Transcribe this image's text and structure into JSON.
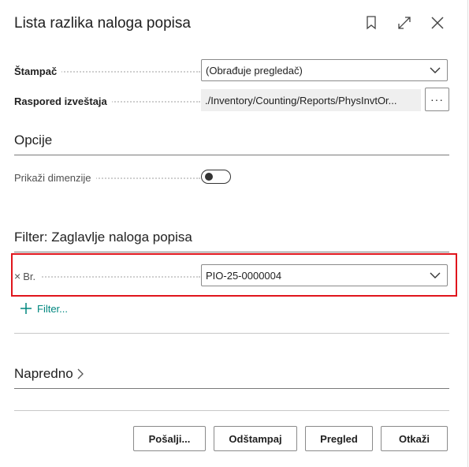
{
  "dialog": {
    "title": "Lista razlika naloga popisa",
    "icons": [
      "bookmark-icon",
      "expand-icon",
      "close-icon"
    ]
  },
  "fields": {
    "printer": {
      "label": "Štampač",
      "value": "(Obrađuje pregledač)"
    },
    "report_layout": {
      "label": "Raspored izveštaja",
      "value": "./Inventory/Counting/Reports/PhysInvtOr...",
      "more": "···"
    }
  },
  "options": {
    "title": "Opcije",
    "show_dimensions": {
      "label": "Prikaži dimenzije",
      "checked": false
    }
  },
  "filter": {
    "title": "Filter: Zaglavlje naloga popisa",
    "remove_symbol": "×",
    "field_label": "Br.",
    "field_value": "PIO-25-0000004",
    "add_filter_label": "Filter..."
  },
  "advanced": {
    "label": "Napredno",
    "chevron": "›"
  },
  "buttons": {
    "send": "Pošalji...",
    "print": "Odštampaj",
    "preview": "Pregled",
    "cancel": "Otkaži"
  },
  "colors": {
    "accent": "#00877f",
    "highlight": "#e0151c"
  }
}
